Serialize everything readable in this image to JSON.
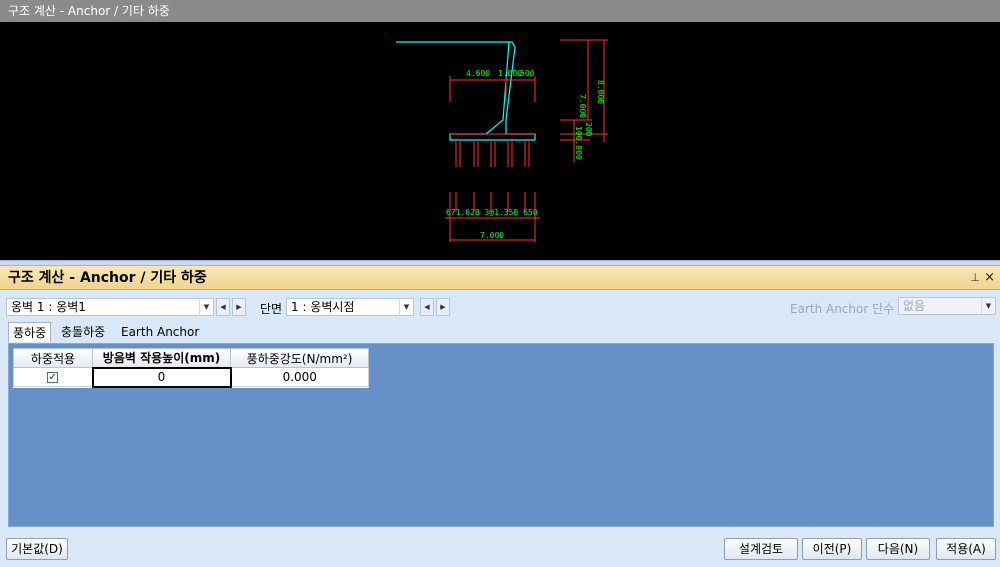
{
  "window": {
    "title": "구조 계산 - Anchor / 기타 하중"
  },
  "cad": {
    "dims": {
      "top_left": "4.600",
      "top_right": "1.000",
      "top_right2": "500",
      "right_total": "7.000",
      "right_total2": "8.000",
      "right_200": "200",
      "right_lower": "100.800",
      "bottom_row": "671.628  3@1.350 650",
      "bottom_total": "7.000"
    }
  },
  "panel": {
    "title": "구조 계산 - Anchor / 기타 하중",
    "pin_icon": "⊥",
    "close_icon": "×",
    "wall_select": "옹벽 1 : 옹벽1",
    "section_label": "단면",
    "section_select": "1 : 옹벽시점",
    "earth_anchor_label": "Earth Anchor 단수",
    "earth_anchor_value": "없음"
  },
  "tabs": [
    {
      "label": "풍하중"
    },
    {
      "label": "충돌하중"
    },
    {
      "label": "Earth Anchor"
    }
  ],
  "grid": {
    "headers": [
      "하중적용",
      "방음벽 작용높이(mm)",
      "풍하중강도(N/mm²)"
    ],
    "row": {
      "checked": "✓",
      "height": "0",
      "intensity": "0.000"
    }
  },
  "buttons": {
    "default": "기본값(D)",
    "review": "설계검토",
    "prev": "이전(P)",
    "next": "다음(N)",
    "apply": "적용(A)"
  }
}
